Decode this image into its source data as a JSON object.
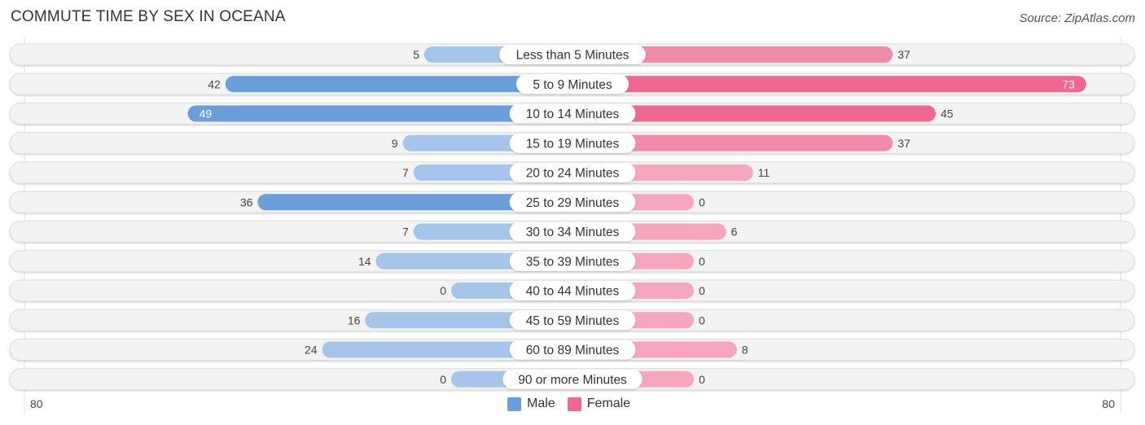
{
  "header": {
    "title": "COMMUTE TIME BY SEX IN OCEANA",
    "source": "Source: ZipAtlas.com"
  },
  "colors": {
    "male_strong": "#6a9fdb",
    "male_light": "#a6c5ea",
    "female_strong": "#f06792",
    "female_light": "#f7a6c0",
    "track": "#f2f2f2"
  },
  "chart_data": {
    "type": "bar",
    "orientation": "horizontal-diverging",
    "title": "COMMUTE TIME BY SEX IN OCEANA",
    "categories": [
      "Less than 5 Minutes",
      "5 to 9 Minutes",
      "10 to 14 Minutes",
      "15 to 19 Minutes",
      "20 to 24 Minutes",
      "25 to 29 Minutes",
      "30 to 34 Minutes",
      "35 to 39 Minutes",
      "40 to 44 Minutes",
      "45 to 59 Minutes",
      "60 to 89 Minutes",
      "90 or more Minutes"
    ],
    "series": [
      {
        "name": "Male",
        "values": [
          5,
          42,
          49,
          9,
          7,
          36,
          7,
          14,
          0,
          16,
          24,
          0
        ]
      },
      {
        "name": "Female",
        "values": [
          37,
          73,
          45,
          37,
          11,
          0,
          6,
          0,
          0,
          0,
          8,
          0
        ]
      }
    ],
    "axis": {
      "left_label": "80",
      "right_label": "80",
      "range": [
        0,
        80
      ]
    },
    "legend": {
      "position": "bottom-center",
      "entries": [
        "Male",
        "Female"
      ]
    }
  }
}
